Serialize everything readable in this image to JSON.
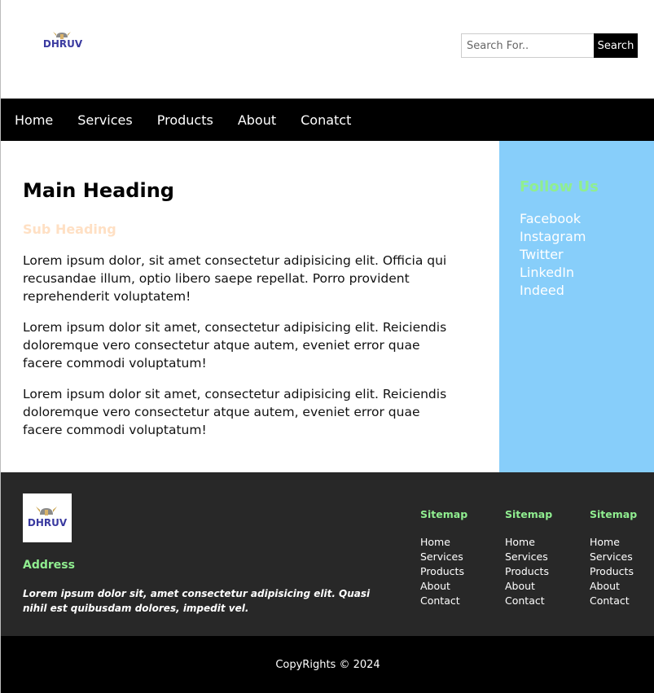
{
  "header": {
    "logo_text": "DHRUV",
    "search": {
      "placeholder": "Search For..",
      "button_label": "Search"
    }
  },
  "nav": {
    "items": [
      "Home",
      "Services",
      "Products",
      "About",
      "Conatct"
    ]
  },
  "main": {
    "heading": "Main Heading",
    "subheading": "Sub Heading",
    "paragraphs": [
      "Lorem ipsum dolor, sit amet consectetur adipisicing elit. Officia qui recusandae illum, optio libero saepe repellat. Porro provident reprehenderit voluptatem!",
      "Lorem ipsum dolor sit amet, consectetur adipisicing elit. Reiciendis doloremque vero consectetur atque autem, eveniet error quae facere commodi voluptatum!",
      "Lorem ipsum dolor sit amet, consectetur adipisicing elit. Reiciendis doloremque vero consectetur atque autem, eveniet error quae facere commodi voluptatum!"
    ]
  },
  "aside": {
    "heading": "Follow Us",
    "links": [
      "Facebook",
      "Instagram",
      "Twitter",
      "LinkedIn",
      "Indeed"
    ]
  },
  "footer": {
    "logo_text": "DHRUV",
    "address_heading": "Address",
    "address_text": "Lorem ipsum dolor sit, amet consectetur adipisicing elit. Quasi nihil est quibusdam dolores, impedit vel.",
    "sitemaps": [
      {
        "title": "Sitemap",
        "links": [
          "Home",
          "Services",
          "Products",
          "About",
          "Contact"
        ]
      },
      {
        "title": "Sitemap",
        "links": [
          "Home",
          "Services",
          "Products",
          "About",
          "Contact"
        ]
      },
      {
        "title": "Sitemap",
        "links": [
          "Home",
          "Services",
          "Products",
          "About",
          "Contact"
        ]
      }
    ]
  },
  "copyright": "CopyRights © 2024",
  "colors": {
    "nav_bg": "#000000",
    "aside_bg": "#87cefa",
    "accent_green": "#90ee90",
    "subheading": "#ffe0c4",
    "footer_bg": "#282828",
    "logo_blue": "#3a3aa0"
  }
}
